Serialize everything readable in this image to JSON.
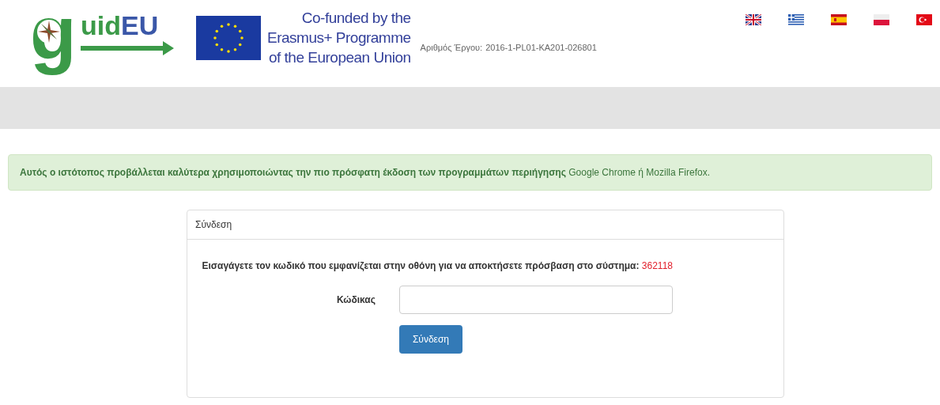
{
  "header": {
    "logo": {
      "initial": "g",
      "middle": "uid",
      "end": "EU"
    },
    "eu_notice": [
      "Co-funded by the",
      "Erasmus+ Programme",
      "of the European Union"
    ],
    "project_label": "Αριθμός Έργου:",
    "project_number": "2016-1-PL01-KA201-026801",
    "languages": [
      {
        "kind": "uk"
      },
      {
        "kind": "greece"
      },
      {
        "kind": "spain"
      },
      {
        "kind": "poland"
      },
      {
        "kind": "turkey"
      }
    ]
  },
  "alert": "**Αυτός ο ιστότοπος προβάλλεται καλύτερα χρησιμοποιώντας την πιο πρόσφατη έκδοση των προγραμμάτων περιήγησης** Google Chrome ή Mozilla Firefox.",
  "login_panel": {
    "title": "Σύνδεση",
    "instruction": "Εισαγάγετε τον κωδικό που εμφανίζεται στην οθόνη για να αποκτήσετε πρόσβαση στο σύστημα:",
    "code": "362118",
    "field_label": "Κώδικας",
    "submit": "Σύνδεση"
  }
}
